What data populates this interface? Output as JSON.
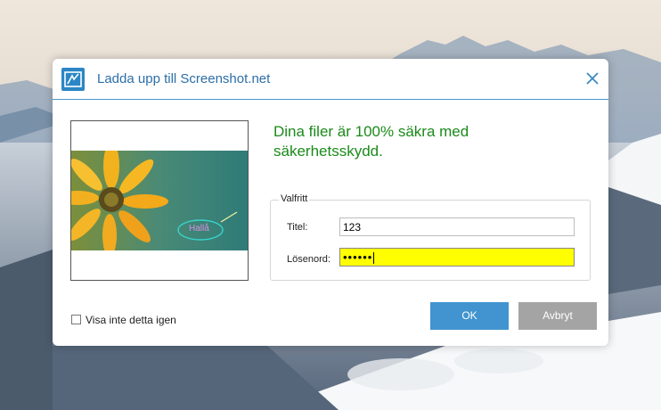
{
  "dialog": {
    "title": "Ladda upp till Screenshot.net",
    "app_icon": "screenshot-app-icon",
    "close_icon": "close-icon",
    "headline": "Dina filer är 100% säkra med säkerhetsskydd.",
    "group_label": "Valfritt",
    "title_label": "Titel:",
    "title_value": "123",
    "password_label": "Lösenord:",
    "password_value": "••••••",
    "preview_annotation": "Hallå",
    "dont_show_label": "Visa inte detta igen",
    "dont_show_checked": false,
    "ok_label": "OK",
    "cancel_label": "Avbryt"
  },
  "colors": {
    "accent": "#2c6fa8",
    "headline": "#1a8a1a",
    "ok_button": "#4194cf",
    "cancel_button": "#a4a4a4",
    "password_highlight": "#ffff00"
  }
}
